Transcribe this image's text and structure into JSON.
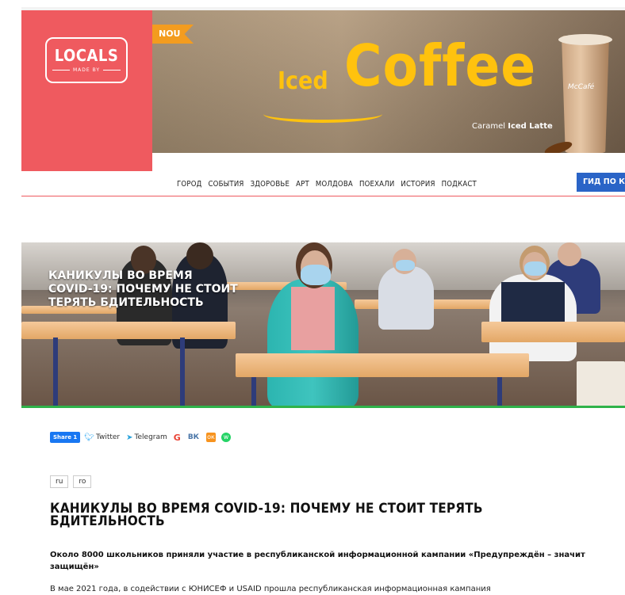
{
  "logo": {
    "text": "LOCALS",
    "sub": "MADE BY"
  },
  "ad": {
    "badge": "NOU",
    "word_iced": "Iced",
    "word_coffee": "Coffee",
    "caramel": "Caramel",
    "iced_latte": "Iced Latte",
    "cup_brand": "McCafé"
  },
  "nav": {
    "items": [
      "ГОРОД",
      "СОБЫТИЯ",
      "ЗДОРОВЬЕ",
      "АРТ",
      "МОЛДОВА",
      "ПОЕХАЛИ",
      "ИСТОРИЯ",
      "ПОДКАСТ"
    ],
    "guide": "ГИД ПО К"
  },
  "hero": {
    "title": "КАНИКУЛЫ ВО ВРЕМЯ COVID-19: ПОЧЕМУ НЕ СТОИТ ТЕРЯТЬ БДИТЕЛЬНОСТЬ"
  },
  "share": {
    "facebook": "Share 1",
    "twitter": "Twitter",
    "telegram": "Telegram",
    "google": "G",
    "vk": "ВК",
    "ok": "ок",
    "whatsapp": "w"
  },
  "languages": [
    "ru",
    "ro"
  ],
  "article": {
    "title": "КАНИКУЛЫ ВО ВРЕМЯ COVID-19: ПОЧЕМУ НЕ СТОИТ ТЕРЯТЬ БДИТЕЛЬНОСТЬ",
    "lead": "Около 8000 школьников приняли участие в республиканской информационной кампании «Предупреждён – значит защищён»",
    "body_start": "В мае 2021 года, в содействии с ЮНИСЕФ и USAID прошла республиканская информационная кампания"
  },
  "colors": {
    "brand": "#ef5a5f",
    "accent_nav": "#2a64c7",
    "hero_underline": "#2fb34a",
    "ad_text": "#ffc20e"
  }
}
